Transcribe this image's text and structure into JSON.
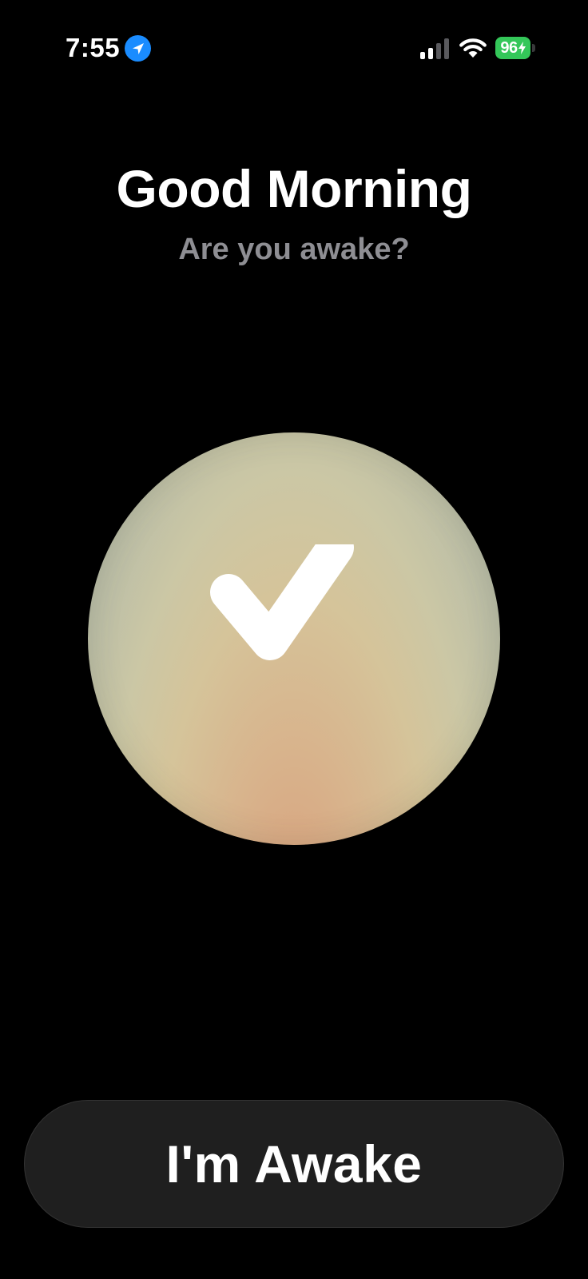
{
  "status_bar": {
    "time": "7:55",
    "battery_percent": "96",
    "battery_charging": true,
    "location_icon": "location-arrow-icon",
    "signal_icon": "cellular-signal-icon",
    "wifi_icon": "wifi-icon",
    "colors": {
      "battery": "#34c759",
      "location": "#1a8cff"
    }
  },
  "header": {
    "title": "Good Morning",
    "subtitle": "Are you awake?"
  },
  "orb": {
    "icon": "checkmark-icon",
    "gradient_colors": [
      "#a9b09f",
      "#cbc7a5",
      "#d5c49a",
      "#d8b38c",
      "#d9a07c"
    ]
  },
  "actions": {
    "awake_label": "I'm Awake"
  }
}
